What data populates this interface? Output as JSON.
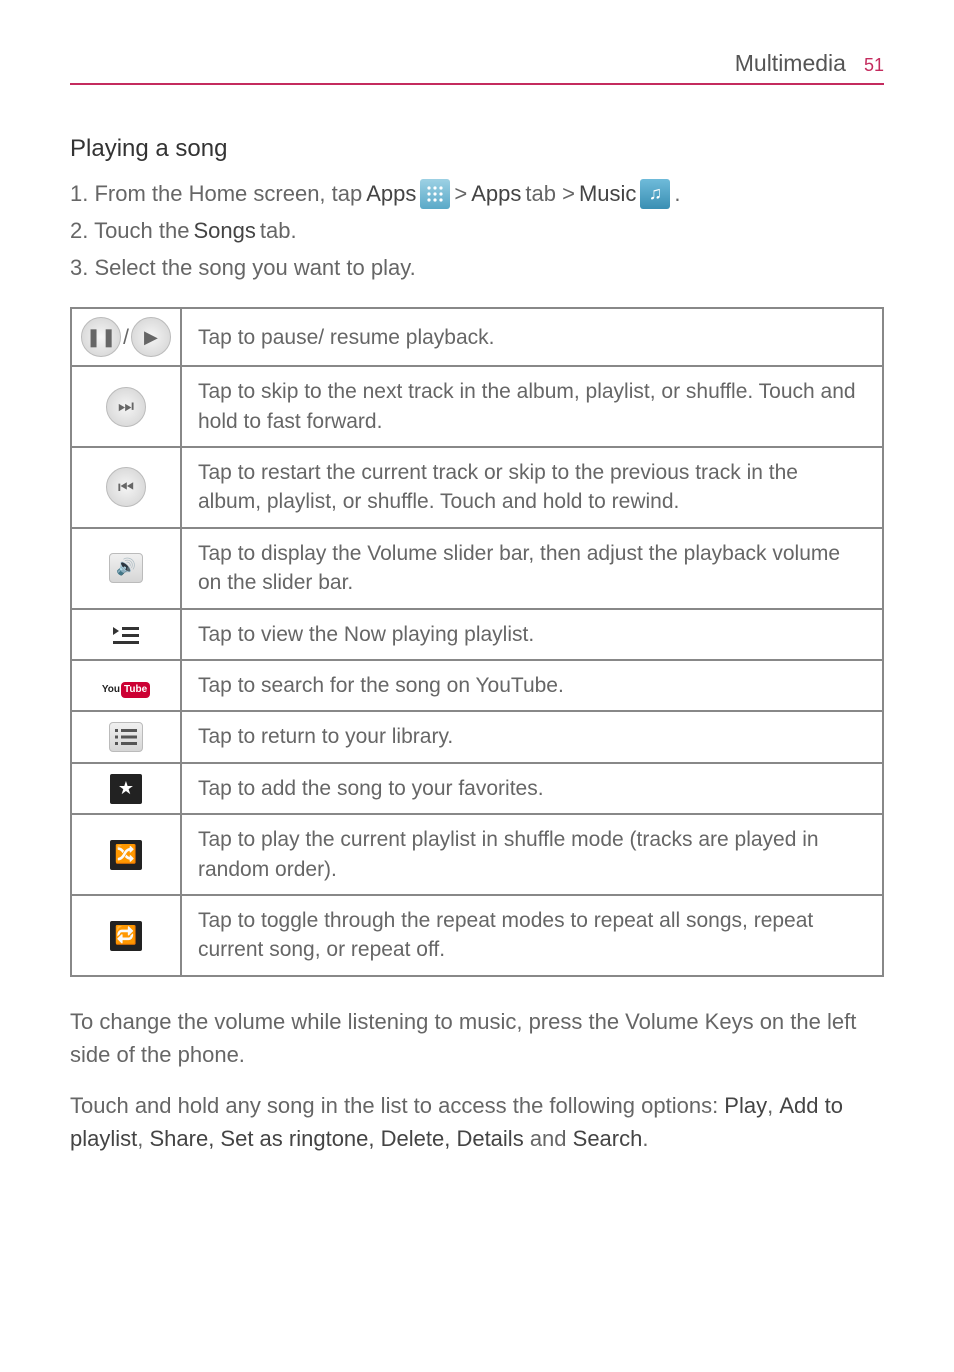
{
  "header": {
    "title": "Multimedia",
    "page_number": "51"
  },
  "section_heading": "Playing a song",
  "steps": {
    "s1_prefix": "1.  From the Home screen, tap ",
    "s1_apps_label": "Apps",
    "s1_mid": " > ",
    "s1_apps_tab": "Apps",
    "s1_tab_word": " tab > ",
    "s1_music_label": "Music",
    "s1_suffix": ".",
    "s2_prefix": "2.  Touch the ",
    "s2_bold": "Songs",
    "s2_suffix": " tab.",
    "s3": "3.  Select the song you want to play."
  },
  "table": {
    "rows": [
      "Tap to pause/ resume playback.",
      "Tap to skip to the next track in the album, playlist, or shuffle. Touch and hold to fast forward.",
      "Tap to restart the current track or skip to the previous track in the album, playlist, or shuffle. Touch and hold to rewind.",
      "Tap to display the Volume slider bar, then adjust the playback volume on the slider bar.",
      "Tap to view the Now playing playlist.",
      "Tap to search for the song on YouTube.",
      "Tap to return to your library.",
      "Tap to add the song to your favorites.",
      "Tap to play the current playlist in shuffle mode (tracks are played in random order).",
      "Tap to toggle through the repeat modes to repeat all songs, repeat current song, or repeat off."
    ]
  },
  "footer": {
    "p1": "To change the volume while listening to music, press the Volume Keys on the left side of the phone.",
    "p2_prefix": "Touch and hold any song in the list to access the following options: ",
    "opt_play": "Play",
    "sep1": ", ",
    "opt_add": "Add to playlist",
    "sep2": ", ",
    "opt_rest": "Share, Set as ringtone, Delete, Details",
    "and": " and ",
    "opt_search": "Search",
    "period": "."
  },
  "icons": {
    "apps_grid": "⋮⋮⋮",
    "music_note": "♫"
  }
}
